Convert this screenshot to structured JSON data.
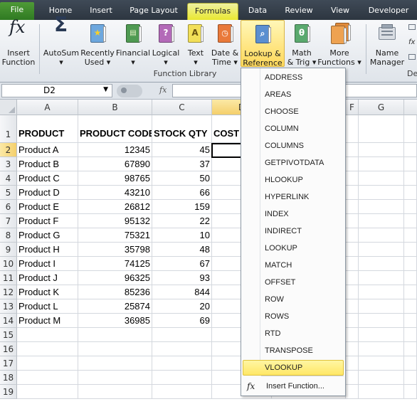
{
  "tabs": [
    "File",
    "Home",
    "Insert",
    "Page Layout",
    "Formulas",
    "Data",
    "Review",
    "View",
    "Developer"
  ],
  "active_tab": "Formulas",
  "ribbon": {
    "buttons": [
      {
        "line1": "Insert",
        "line2": "Function",
        "icon": "fx-icon"
      },
      {
        "line1": "AutoSum",
        "line2": "▾",
        "icon": "sigma-icon"
      },
      {
        "line1": "Recently",
        "line2": "Used ▾",
        "icon": "star-book-icon"
      },
      {
        "line1": "Financial",
        "line2": "▾",
        "icon": "financial-book-icon"
      },
      {
        "line1": "Logical",
        "line2": "▾",
        "icon": "question-book-icon"
      },
      {
        "line1": "Text",
        "line2": "▾",
        "icon": "text-book-icon"
      },
      {
        "line1": "Date &",
        "line2": "Time ▾",
        "icon": "clock-book-icon"
      },
      {
        "line1": "Lookup &",
        "line2": "Reference ▾",
        "icon": "magnifier-book-icon"
      },
      {
        "line1": "Math",
        "line2": "& Trig ▾",
        "icon": "theta-book-icon"
      },
      {
        "line1": "More",
        "line2": "Functions ▾",
        "icon": "stack-books-icon"
      },
      {
        "line1": "Name",
        "line2": "Manager",
        "icon": "name-manager-icon"
      }
    ],
    "group_label": "Function Library",
    "right_cut_label": "De"
  },
  "formula_bar": {
    "name_box": "D2",
    "fx": "fx",
    "formula": ""
  },
  "columns": [
    "A",
    "B",
    "C",
    "D",
    "E",
    "F",
    "G"
  ],
  "headers": {
    "a": "PRODUCT",
    "b": "PRODUCT CODE",
    "c": "STOCK QTY",
    "d": "COST I"
  },
  "rows": [
    {
      "product": "Product A",
      "code": "12345",
      "qty": "45"
    },
    {
      "product": "Product B",
      "code": "67890",
      "qty": "37"
    },
    {
      "product": "Product C",
      "code": "98765",
      "qty": "50"
    },
    {
      "product": "Product D",
      "code": "43210",
      "qty": "66"
    },
    {
      "product": "Product E",
      "code": "26812",
      "qty": "159"
    },
    {
      "product": "Product F",
      "code": "95132",
      "qty": "22"
    },
    {
      "product": "Product G",
      "code": "75321",
      "qty": "10"
    },
    {
      "product": "Product H",
      "code": "35798",
      "qty": "48"
    },
    {
      "product": "Product I",
      "code": "74125",
      "qty": "67"
    },
    {
      "product": "Product J",
      "code": "96325",
      "qty": "93"
    },
    {
      "product": "Product K",
      "code": "85236",
      "qty": "844"
    },
    {
      "product": "Product L",
      "code": "25874",
      "qty": "20"
    },
    {
      "product": "Product M",
      "code": "36985",
      "qty": "69"
    }
  ],
  "row_numbers": [
    "1",
    "2",
    "3",
    "4",
    "5",
    "6",
    "7",
    "8",
    "9",
    "10",
    "11",
    "12",
    "13",
    "14",
    "15",
    "16",
    "17",
    "18",
    "19"
  ],
  "menu": {
    "items": [
      "ADDRESS",
      "AREAS",
      "CHOOSE",
      "COLUMN",
      "COLUMNS",
      "GETPIVOTDATA",
      "HLOOKUP",
      "HYPERLINK",
      "INDEX",
      "INDIRECT",
      "LOOKUP",
      "MATCH",
      "OFFSET",
      "ROW",
      "ROWS",
      "RTD",
      "TRANSPOSE",
      "VLOOKUP"
    ],
    "highlighted": "VLOOKUP",
    "insert_function": "Insert Function..."
  },
  "colors": {
    "file_tab": "#3f8a2c",
    "active_tab": "#e8e833",
    "highlight": "#ffe766",
    "selection_header": "#f4cf6b"
  }
}
